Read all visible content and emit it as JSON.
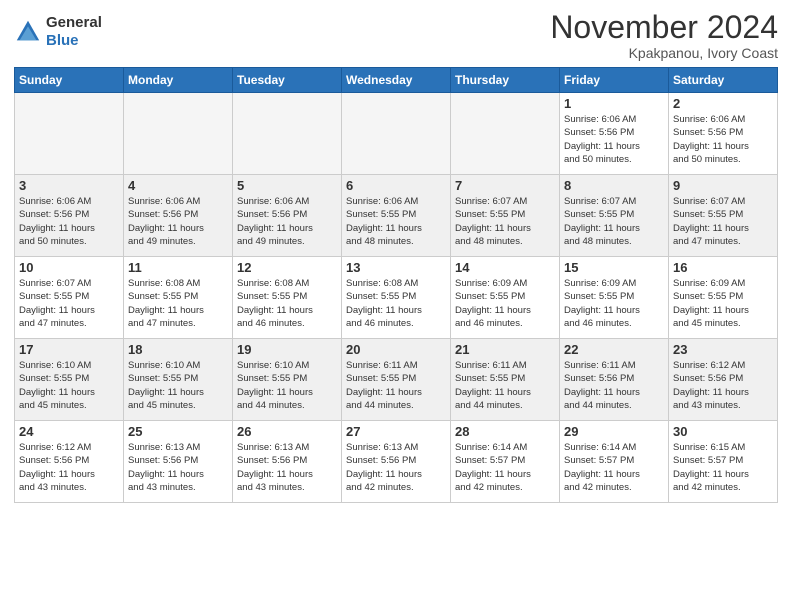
{
  "logo": {
    "general": "General",
    "blue": "Blue"
  },
  "header": {
    "month": "November 2024",
    "location": "Kpakpanou, Ivory Coast"
  },
  "weekdays": [
    "Sunday",
    "Monday",
    "Tuesday",
    "Wednesday",
    "Thursday",
    "Friday",
    "Saturday"
  ],
  "weeks": [
    [
      {
        "day": "",
        "info": ""
      },
      {
        "day": "",
        "info": ""
      },
      {
        "day": "",
        "info": ""
      },
      {
        "day": "",
        "info": ""
      },
      {
        "day": "",
        "info": ""
      },
      {
        "day": "1",
        "info": "Sunrise: 6:06 AM\nSunset: 5:56 PM\nDaylight: 11 hours\nand 50 minutes."
      },
      {
        "day": "2",
        "info": "Sunrise: 6:06 AM\nSunset: 5:56 PM\nDaylight: 11 hours\nand 50 minutes."
      }
    ],
    [
      {
        "day": "3",
        "info": "Sunrise: 6:06 AM\nSunset: 5:56 PM\nDaylight: 11 hours\nand 50 minutes."
      },
      {
        "day": "4",
        "info": "Sunrise: 6:06 AM\nSunset: 5:56 PM\nDaylight: 11 hours\nand 49 minutes."
      },
      {
        "day": "5",
        "info": "Sunrise: 6:06 AM\nSunset: 5:56 PM\nDaylight: 11 hours\nand 49 minutes."
      },
      {
        "day": "6",
        "info": "Sunrise: 6:06 AM\nSunset: 5:55 PM\nDaylight: 11 hours\nand 48 minutes."
      },
      {
        "day": "7",
        "info": "Sunrise: 6:07 AM\nSunset: 5:55 PM\nDaylight: 11 hours\nand 48 minutes."
      },
      {
        "day": "8",
        "info": "Sunrise: 6:07 AM\nSunset: 5:55 PM\nDaylight: 11 hours\nand 48 minutes."
      },
      {
        "day": "9",
        "info": "Sunrise: 6:07 AM\nSunset: 5:55 PM\nDaylight: 11 hours\nand 47 minutes."
      }
    ],
    [
      {
        "day": "10",
        "info": "Sunrise: 6:07 AM\nSunset: 5:55 PM\nDaylight: 11 hours\nand 47 minutes."
      },
      {
        "day": "11",
        "info": "Sunrise: 6:08 AM\nSunset: 5:55 PM\nDaylight: 11 hours\nand 47 minutes."
      },
      {
        "day": "12",
        "info": "Sunrise: 6:08 AM\nSunset: 5:55 PM\nDaylight: 11 hours\nand 46 minutes."
      },
      {
        "day": "13",
        "info": "Sunrise: 6:08 AM\nSunset: 5:55 PM\nDaylight: 11 hours\nand 46 minutes."
      },
      {
        "day": "14",
        "info": "Sunrise: 6:09 AM\nSunset: 5:55 PM\nDaylight: 11 hours\nand 46 minutes."
      },
      {
        "day": "15",
        "info": "Sunrise: 6:09 AM\nSunset: 5:55 PM\nDaylight: 11 hours\nand 46 minutes."
      },
      {
        "day": "16",
        "info": "Sunrise: 6:09 AM\nSunset: 5:55 PM\nDaylight: 11 hours\nand 45 minutes."
      }
    ],
    [
      {
        "day": "17",
        "info": "Sunrise: 6:10 AM\nSunset: 5:55 PM\nDaylight: 11 hours\nand 45 minutes."
      },
      {
        "day": "18",
        "info": "Sunrise: 6:10 AM\nSunset: 5:55 PM\nDaylight: 11 hours\nand 45 minutes."
      },
      {
        "day": "19",
        "info": "Sunrise: 6:10 AM\nSunset: 5:55 PM\nDaylight: 11 hours\nand 44 minutes."
      },
      {
        "day": "20",
        "info": "Sunrise: 6:11 AM\nSunset: 5:55 PM\nDaylight: 11 hours\nand 44 minutes."
      },
      {
        "day": "21",
        "info": "Sunrise: 6:11 AM\nSunset: 5:55 PM\nDaylight: 11 hours\nand 44 minutes."
      },
      {
        "day": "22",
        "info": "Sunrise: 6:11 AM\nSunset: 5:56 PM\nDaylight: 11 hours\nand 44 minutes."
      },
      {
        "day": "23",
        "info": "Sunrise: 6:12 AM\nSunset: 5:56 PM\nDaylight: 11 hours\nand 43 minutes."
      }
    ],
    [
      {
        "day": "24",
        "info": "Sunrise: 6:12 AM\nSunset: 5:56 PM\nDaylight: 11 hours\nand 43 minutes."
      },
      {
        "day": "25",
        "info": "Sunrise: 6:13 AM\nSunset: 5:56 PM\nDaylight: 11 hours\nand 43 minutes."
      },
      {
        "day": "26",
        "info": "Sunrise: 6:13 AM\nSunset: 5:56 PM\nDaylight: 11 hours\nand 43 minutes."
      },
      {
        "day": "27",
        "info": "Sunrise: 6:13 AM\nSunset: 5:56 PM\nDaylight: 11 hours\nand 42 minutes."
      },
      {
        "day": "28",
        "info": "Sunrise: 6:14 AM\nSunset: 5:57 PM\nDaylight: 11 hours\nand 42 minutes."
      },
      {
        "day": "29",
        "info": "Sunrise: 6:14 AM\nSunset: 5:57 PM\nDaylight: 11 hours\nand 42 minutes."
      },
      {
        "day": "30",
        "info": "Sunrise: 6:15 AM\nSunset: 5:57 PM\nDaylight: 11 hours\nand 42 minutes."
      }
    ]
  ]
}
